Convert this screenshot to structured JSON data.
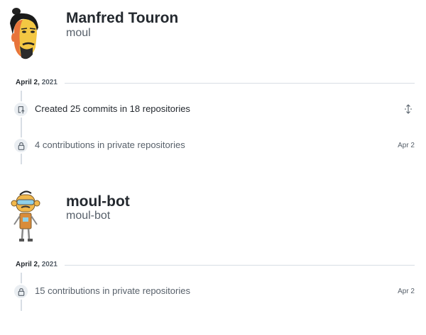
{
  "profiles": [
    {
      "name": "Manfred Touron",
      "login": "moul",
      "date": {
        "month_day": "April 2,",
        "year": "2021"
      },
      "items": [
        {
          "text": "Created 25 commits in 18 repositories",
          "icon": "repo-push-icon",
          "action": "expand-icon"
        },
        {
          "text": "4 contributions in private repositories",
          "icon": "lock-icon",
          "date": "Apr 2"
        }
      ]
    },
    {
      "name": "moul-bot",
      "login": "moul-bot",
      "date": {
        "month_day": "April 2,",
        "year": "2021"
      },
      "items": [
        {
          "text": "15 contributions in private repositories",
          "icon": "lock-icon",
          "date": "Apr 2"
        }
      ]
    }
  ],
  "colors": {
    "text": "#24292f",
    "muted": "#57606a",
    "line": "#d8dee4",
    "badge": "#eaeef2"
  }
}
